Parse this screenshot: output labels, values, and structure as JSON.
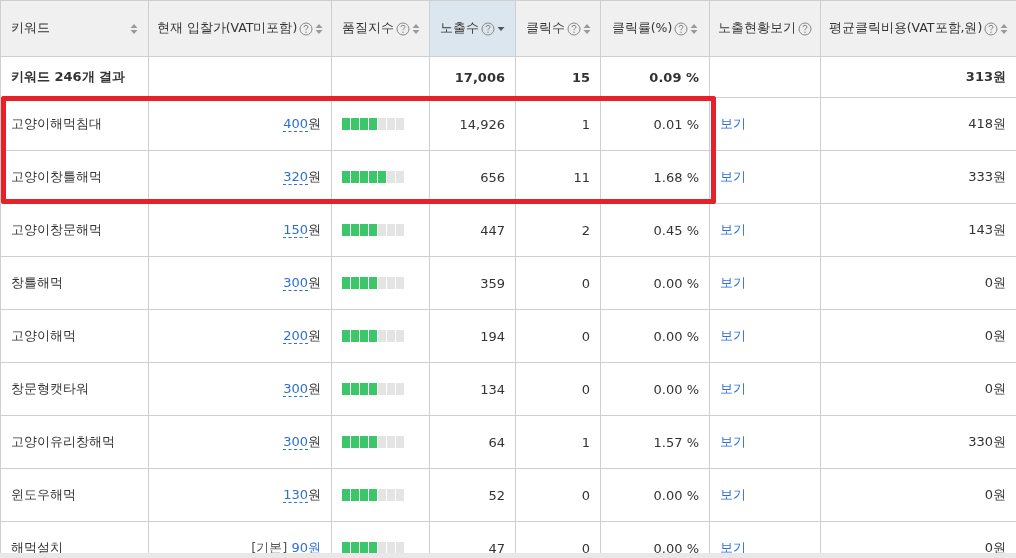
{
  "table": {
    "columns": [
      {
        "label": "키워드",
        "help": false,
        "sortable": true,
        "sorted": false
      },
      {
        "label": "현재 입찰가(VAT미포함)",
        "help": true,
        "sortable": true,
        "sorted": false
      },
      {
        "label": "품질지수",
        "help": true,
        "sortable": true,
        "sorted": false
      },
      {
        "label": "노출수",
        "help": true,
        "sortable": true,
        "sorted": true
      },
      {
        "label": "클릭수",
        "help": true,
        "sortable": true,
        "sorted": false
      },
      {
        "label": "클릭률(%)",
        "help": true,
        "sortable": true,
        "sorted": false
      },
      {
        "label": "노출현황보기",
        "help": true,
        "sortable": false,
        "sorted": false
      },
      {
        "label": "평균클릭비용(VAT포함,원)",
        "help": true,
        "sortable": true,
        "sorted": false
      }
    ],
    "summary": {
      "keyword": "키워드 246개 결과",
      "impressions": "17,006",
      "clicks": "15",
      "ctr": "0.09 %",
      "avg_cpc": "313원"
    },
    "rows": [
      {
        "keyword": "고양이해먹침대",
        "bid": {
          "kind": "custom",
          "amount": "400",
          "unit": "원"
        },
        "quality": {
          "level": 0.5714
        },
        "impressions": "14,926",
        "clicks": "1",
        "ctr": "0.01 %",
        "view": "보기",
        "avg_cpc": "418원",
        "highlighted": true
      },
      {
        "keyword": "고양이창틀해먹",
        "bid": {
          "kind": "custom",
          "amount": "320",
          "unit": "원"
        },
        "quality": {
          "level": 0.7143
        },
        "impressions": "656",
        "clicks": "11",
        "ctr": "1.68 %",
        "view": "보기",
        "avg_cpc": "333원",
        "highlighted": true
      },
      {
        "keyword": "고양이창문해먹",
        "bid": {
          "kind": "custom",
          "amount": "150",
          "unit": "원"
        },
        "quality": {
          "level": 0.5714
        },
        "impressions": "447",
        "clicks": "2",
        "ctr": "0.45 %",
        "view": "보기",
        "avg_cpc": "143원",
        "highlighted": false
      },
      {
        "keyword": "창틀해먹",
        "bid": {
          "kind": "custom",
          "amount": "300",
          "unit": "원"
        },
        "quality": {
          "level": 0.5714
        },
        "impressions": "359",
        "clicks": "0",
        "ctr": "0.00 %",
        "view": "보기",
        "avg_cpc": "0원",
        "highlighted": false
      },
      {
        "keyword": "고양이해먹",
        "bid": {
          "kind": "custom",
          "amount": "200",
          "unit": "원"
        },
        "quality": {
          "level": 0.5714
        },
        "impressions": "194",
        "clicks": "0",
        "ctr": "0.00 %",
        "view": "보기",
        "avg_cpc": "0원",
        "highlighted": false
      },
      {
        "keyword": "창문형캣타워",
        "bid": {
          "kind": "custom",
          "amount": "300",
          "unit": "원"
        },
        "quality": {
          "level": 0.5714
        },
        "impressions": "134",
        "clicks": "0",
        "ctr": "0.00 %",
        "view": "보기",
        "avg_cpc": "0원",
        "highlighted": false
      },
      {
        "keyword": "고양이유리창해먹",
        "bid": {
          "kind": "custom",
          "amount": "300",
          "unit": "원"
        },
        "quality": {
          "level": 0.5714
        },
        "impressions": "64",
        "clicks": "1",
        "ctr": "1.57 %",
        "view": "보기",
        "avg_cpc": "330원",
        "highlighted": false
      },
      {
        "keyword": "윈도우해먹",
        "bid": {
          "kind": "custom",
          "amount": "130",
          "unit": "원"
        },
        "quality": {
          "level": 0.5714
        },
        "impressions": "52",
        "clicks": "0",
        "ctr": "0.00 %",
        "view": "보기",
        "avg_cpc": "0원",
        "highlighted": false
      },
      {
        "keyword": "해먹설치",
        "bid": {
          "kind": "default",
          "prefix": "[기본]",
          "amount": "90",
          "unit": "원"
        },
        "quality": {
          "level": 0.5714
        },
        "impressions": "47",
        "clicks": "0",
        "ctr": "0.00 %",
        "view": "보기",
        "avg_cpc": "0원",
        "highlighted": false
      }
    ]
  }
}
